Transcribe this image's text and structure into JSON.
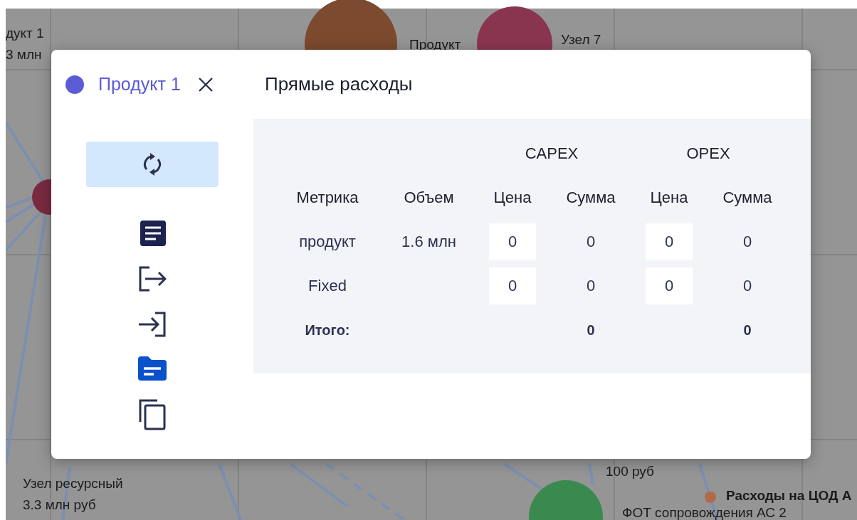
{
  "backdrop": {
    "nodes": [
      {
        "color": "#7b4a2f"
      },
      {
        "color": "#8a3550"
      },
      {
        "color": "#7a2a40"
      },
      {
        "color": "#3a8a50"
      },
      {
        "color": "#b06a48"
      }
    ],
    "labels": [
      "дукт 1",
      "3 млн",
      "Продукт",
      "Узел 7",
      "Узел ресурсный",
      "3.3 млн руб",
      "100 руб",
      "Расходы на ЦОД А",
      "ФОТ сопровождения АС 2"
    ]
  },
  "dialog": {
    "title": "Продукт 1",
    "section_title": "Прямые расходы",
    "tools": [
      {
        "kind": "refresh",
        "selected": true
      },
      {
        "kind": "document",
        "selected": false
      },
      {
        "kind": "export",
        "selected": false
      },
      {
        "kind": "import",
        "selected": false
      },
      {
        "kind": "folder",
        "selected": false
      },
      {
        "kind": "copy",
        "selected": false
      }
    ],
    "table": {
      "groups": [
        "CAPEX",
        "OPEX"
      ],
      "columns": [
        "Метрика",
        "Объем",
        "Цена",
        "Сумма",
        "Цена",
        "Сумма"
      ],
      "rows": [
        {
          "metric": "продукт",
          "volume": "1.6 млн",
          "capex_price": "0",
          "capex_sum": "0",
          "opex_price": "0",
          "opex_sum": "0"
        },
        {
          "metric": "Fixed",
          "capex_price": "0",
          "capex_sum": "0",
          "opex_price": "0",
          "opex_sum": "0"
        }
      ],
      "total": {
        "label": "Итого:",
        "capex_sum": "0",
        "opex_sum": "0"
      }
    }
  }
}
